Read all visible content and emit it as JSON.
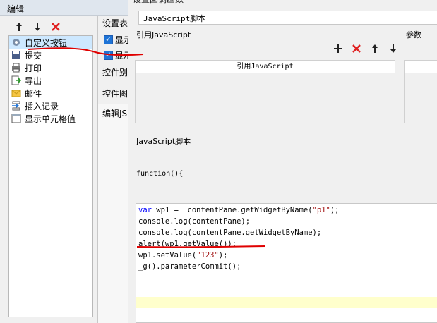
{
  "left_window": {
    "title": "编辑",
    "toolbar": {
      "up": "↑",
      "down": "↓",
      "delete": "✕"
    },
    "items": [
      {
        "label": "自定义按钮",
        "icon": "gear-icon"
      },
      {
        "label": "提交",
        "icon": "save-icon"
      },
      {
        "label": "打印",
        "icon": "printer-icon"
      },
      {
        "label": "导出",
        "icon": "export-icon"
      },
      {
        "label": "邮件",
        "icon": "mail-icon"
      },
      {
        "label": "插入记录",
        "icon": "insert-record-icon"
      },
      {
        "label": "显示单元格值",
        "icon": "cell-icon"
      }
    ]
  },
  "middle_panel": {
    "heading": "设置表",
    "check1_label": "显示",
    "check2_label": "显示",
    "widget_label1": "控件别",
    "widget_label2": "控件图",
    "edit_label": "编辑JS"
  },
  "right_window": {
    "title": "设置回调函数",
    "script_header": "JavaScript脚本",
    "ref_label": "引用JavaScript",
    "param_label": "参数",
    "ref_column_header": "引用JavaScript",
    "js_label": "JavaScript脚本",
    "function_decl": "function(){",
    "toolbar": {
      "add": "+",
      "delete": "✕",
      "up": "↑",
      "down": "↓"
    }
  },
  "code": {
    "line1_kw": "var",
    "line1_a": " wp1 =  contentPane.getWidgetByName(",
    "line1_str": "\"p1\"",
    "line1_b": ");",
    "line2": "console.log(contentPane);",
    "line3": "console.log(contentPane.getWidgetByName);",
    "line4": "alert(wp1.getValue());",
    "line5_a": "wp1.setValue(",
    "line5_str": "\"123\"",
    "line5_b": ");",
    "line6": "_g().parameterCommit();"
  },
  "colors": {
    "selected": "#cde8ff",
    "annotation": "#e00000",
    "keyword": "#0000ff",
    "string": "#a31515"
  }
}
